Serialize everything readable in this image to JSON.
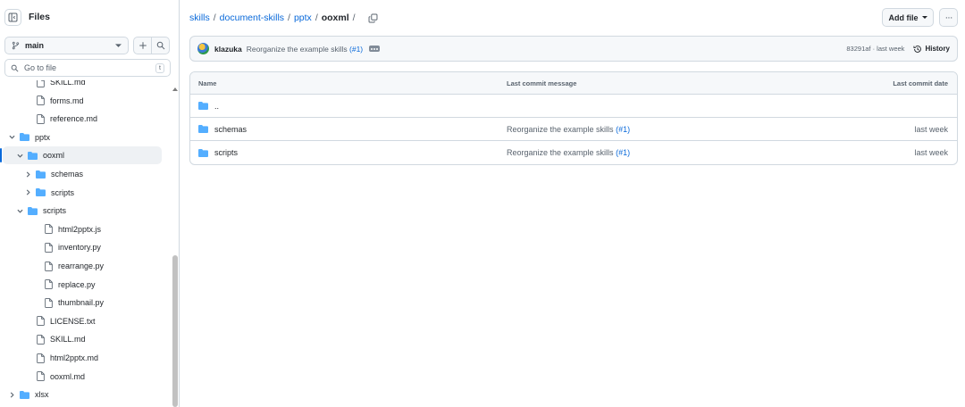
{
  "sidebar": {
    "title": "Files",
    "branch": "main",
    "search_placeholder": "Go to file",
    "search_shortcut": "t",
    "tree": [
      {
        "name": "SKILL.md",
        "type": "file",
        "depth": 2
      },
      {
        "name": "forms.md",
        "type": "file",
        "depth": 2
      },
      {
        "name": "reference.md",
        "type": "file",
        "depth": 2
      },
      {
        "name": "pptx",
        "type": "folder",
        "depth": 1,
        "expanded": true
      },
      {
        "name": "ooxml",
        "type": "folder",
        "depth": 2,
        "expanded": true,
        "selected": true
      },
      {
        "name": "schemas",
        "type": "folder",
        "depth": 3,
        "expanded": false
      },
      {
        "name": "scripts",
        "type": "folder",
        "depth": 3,
        "expanded": false
      },
      {
        "name": "scripts",
        "type": "folder",
        "depth": 2,
        "expanded": true
      },
      {
        "name": "html2pptx.js",
        "type": "file",
        "depth": 3
      },
      {
        "name": "inventory.py",
        "type": "file",
        "depth": 3
      },
      {
        "name": "rearrange.py",
        "type": "file",
        "depth": 3
      },
      {
        "name": "replace.py",
        "type": "file",
        "depth": 3
      },
      {
        "name": "thumbnail.py",
        "type": "file",
        "depth": 3
      },
      {
        "name": "LICENSE.txt",
        "type": "file",
        "depth": 2
      },
      {
        "name": "SKILL.md",
        "type": "file",
        "depth": 2
      },
      {
        "name": "html2pptx.md",
        "type": "file",
        "depth": 2
      },
      {
        "name": "ooxml.md",
        "type": "file",
        "depth": 2
      },
      {
        "name": "xlsx",
        "type": "folder",
        "depth": 1,
        "expanded": false
      }
    ]
  },
  "breadcrumb": {
    "parts": [
      "skills",
      "document-skills",
      "pptx"
    ],
    "current": "ooxml",
    "sep": "/"
  },
  "actions": {
    "add_file": "Add file",
    "more": "···"
  },
  "commit": {
    "author": "klazuka",
    "message": "Reorganize the example skills",
    "pr": "(#1)",
    "meta": "83291af · last week",
    "history_label": "History"
  },
  "table": {
    "headers": {
      "name": "Name",
      "message": "Last commit message",
      "date": "Last commit date"
    },
    "parent_label": "..",
    "rows": [
      {
        "name": "schemas",
        "message": "Reorganize the example skills",
        "pr": "(#1)",
        "date": "last week"
      },
      {
        "name": "scripts",
        "message": "Reorganize the example skills",
        "pr": "(#1)",
        "date": "last week"
      }
    ]
  },
  "colors": {
    "accent": "#0969da",
    "folder": "#54aeff",
    "border": "#d1d9e0",
    "muted": "#59636e"
  }
}
